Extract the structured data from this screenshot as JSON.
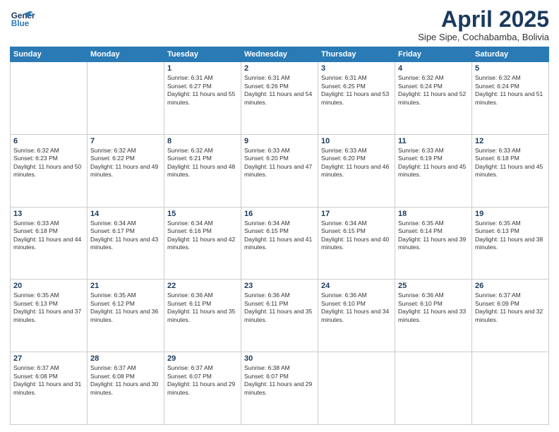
{
  "logo": {
    "line1": "General",
    "line2": "Blue"
  },
  "title": "April 2025",
  "subtitle": "Sipe Sipe, Cochabamba, Bolivia",
  "days_header": [
    "Sunday",
    "Monday",
    "Tuesday",
    "Wednesday",
    "Thursday",
    "Friday",
    "Saturday"
  ],
  "weeks": [
    [
      {
        "day": "",
        "info": ""
      },
      {
        "day": "",
        "info": ""
      },
      {
        "day": "1",
        "info": "Sunrise: 6:31 AM\nSunset: 6:27 PM\nDaylight: 11 hours and 55 minutes."
      },
      {
        "day": "2",
        "info": "Sunrise: 6:31 AM\nSunset: 6:26 PM\nDaylight: 11 hours and 54 minutes."
      },
      {
        "day": "3",
        "info": "Sunrise: 6:31 AM\nSunset: 6:25 PM\nDaylight: 11 hours and 53 minutes."
      },
      {
        "day": "4",
        "info": "Sunrise: 6:32 AM\nSunset: 6:24 PM\nDaylight: 11 hours and 52 minutes."
      },
      {
        "day": "5",
        "info": "Sunrise: 6:32 AM\nSunset: 6:24 PM\nDaylight: 11 hours and 51 minutes."
      }
    ],
    [
      {
        "day": "6",
        "info": "Sunrise: 6:32 AM\nSunset: 6:23 PM\nDaylight: 11 hours and 50 minutes."
      },
      {
        "day": "7",
        "info": "Sunrise: 6:32 AM\nSunset: 6:22 PM\nDaylight: 11 hours and 49 minutes."
      },
      {
        "day": "8",
        "info": "Sunrise: 6:32 AM\nSunset: 6:21 PM\nDaylight: 11 hours and 48 minutes."
      },
      {
        "day": "9",
        "info": "Sunrise: 6:33 AM\nSunset: 6:20 PM\nDaylight: 11 hours and 47 minutes."
      },
      {
        "day": "10",
        "info": "Sunrise: 6:33 AM\nSunset: 6:20 PM\nDaylight: 11 hours and 46 minutes."
      },
      {
        "day": "11",
        "info": "Sunrise: 6:33 AM\nSunset: 6:19 PM\nDaylight: 11 hours and 45 minutes."
      },
      {
        "day": "12",
        "info": "Sunrise: 6:33 AM\nSunset: 6:18 PM\nDaylight: 11 hours and 45 minutes."
      }
    ],
    [
      {
        "day": "13",
        "info": "Sunrise: 6:33 AM\nSunset: 6:18 PM\nDaylight: 11 hours and 44 minutes."
      },
      {
        "day": "14",
        "info": "Sunrise: 6:34 AM\nSunset: 6:17 PM\nDaylight: 11 hours and 43 minutes."
      },
      {
        "day": "15",
        "info": "Sunrise: 6:34 AM\nSunset: 6:16 PM\nDaylight: 11 hours and 42 minutes."
      },
      {
        "day": "16",
        "info": "Sunrise: 6:34 AM\nSunset: 6:15 PM\nDaylight: 11 hours and 41 minutes."
      },
      {
        "day": "17",
        "info": "Sunrise: 6:34 AM\nSunset: 6:15 PM\nDaylight: 11 hours and 40 minutes."
      },
      {
        "day": "18",
        "info": "Sunrise: 6:35 AM\nSunset: 6:14 PM\nDaylight: 11 hours and 39 minutes."
      },
      {
        "day": "19",
        "info": "Sunrise: 6:35 AM\nSunset: 6:13 PM\nDaylight: 11 hours and 38 minutes."
      }
    ],
    [
      {
        "day": "20",
        "info": "Sunrise: 6:35 AM\nSunset: 6:13 PM\nDaylight: 11 hours and 37 minutes."
      },
      {
        "day": "21",
        "info": "Sunrise: 6:35 AM\nSunset: 6:12 PM\nDaylight: 11 hours and 36 minutes."
      },
      {
        "day": "22",
        "info": "Sunrise: 6:36 AM\nSunset: 6:11 PM\nDaylight: 11 hours and 35 minutes."
      },
      {
        "day": "23",
        "info": "Sunrise: 6:36 AM\nSunset: 6:11 PM\nDaylight: 11 hours and 35 minutes."
      },
      {
        "day": "24",
        "info": "Sunrise: 6:36 AM\nSunset: 6:10 PM\nDaylight: 11 hours and 34 minutes."
      },
      {
        "day": "25",
        "info": "Sunrise: 6:36 AM\nSunset: 6:10 PM\nDaylight: 11 hours and 33 minutes."
      },
      {
        "day": "26",
        "info": "Sunrise: 6:37 AM\nSunset: 6:09 PM\nDaylight: 11 hours and 32 minutes."
      }
    ],
    [
      {
        "day": "27",
        "info": "Sunrise: 6:37 AM\nSunset: 6:08 PM\nDaylight: 11 hours and 31 minutes."
      },
      {
        "day": "28",
        "info": "Sunrise: 6:37 AM\nSunset: 6:08 PM\nDaylight: 11 hours and 30 minutes."
      },
      {
        "day": "29",
        "info": "Sunrise: 6:37 AM\nSunset: 6:07 PM\nDaylight: 11 hours and 29 minutes."
      },
      {
        "day": "30",
        "info": "Sunrise: 6:38 AM\nSunset: 6:07 PM\nDaylight: 11 hours and 29 minutes."
      },
      {
        "day": "",
        "info": ""
      },
      {
        "day": "",
        "info": ""
      },
      {
        "day": "",
        "info": ""
      }
    ]
  ]
}
